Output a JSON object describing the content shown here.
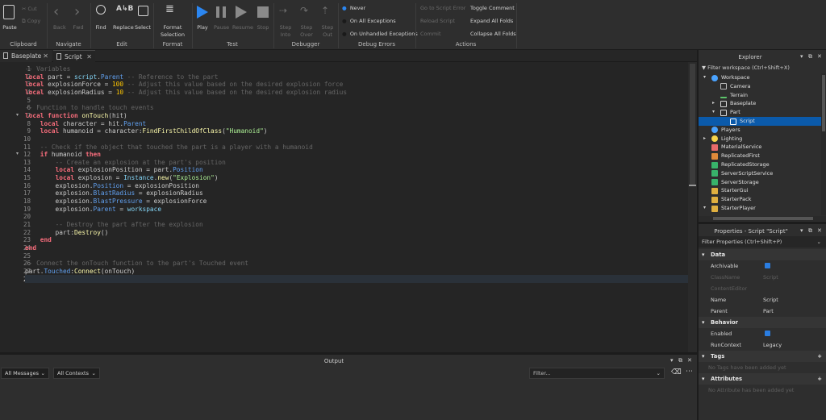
{
  "ribbon": {
    "clipboard": {
      "paste": "Paste",
      "cut": "Cut",
      "copy": "Copy",
      "label": "Clipboard"
    },
    "navigate": {
      "back": "Back",
      "fwd": "Fwd",
      "label": "Navigate"
    },
    "edit": {
      "find": "Find",
      "replace": "Replace",
      "select": "Select",
      "label": "Edit"
    },
    "format": {
      "selection": "Format Selection",
      "label": "Format"
    },
    "test": {
      "play": "Play",
      "pause": "Pause",
      "resume": "Resume",
      "stop": "Stop",
      "label": "Test"
    },
    "debugger": {
      "step_into": "Step Into",
      "step_over": "Step Over",
      "step_out": "Step Out",
      "label": "Debugger"
    },
    "debug_errors": {
      "never": "Never",
      "all": "On All Exceptions",
      "unhandled": "On Unhandled Exceptions",
      "label": "Debug Errors"
    },
    "actions": {
      "goto_error": "Go to Script Error",
      "reload": "Reload Script",
      "commit": "Commit",
      "toggle_comment": "Toggle Comment",
      "expand": "Expand All Folds",
      "collapse": "Collapse All Folds",
      "label": "Actions"
    }
  },
  "tabs": [
    {
      "label": "Baseplate"
    },
    {
      "label": "Script"
    }
  ],
  "editor": {
    "line_numbers": [
      "1",
      "2",
      "3",
      "4",
      "5",
      "6",
      "7",
      "8",
      "9",
      "10",
      "11",
      "12",
      "13",
      "14",
      "15",
      "16",
      "17",
      "18",
      "19",
      "20",
      "21",
      "22",
      "23",
      "24",
      "25",
      "26",
      "27",
      "28"
    ]
  },
  "output": {
    "title": "Output",
    "messages_filter": "All Messages",
    "contexts_filter": "All Contexts",
    "filter_placeholder": "Filter..."
  },
  "explorer": {
    "title": "Explorer",
    "filter": "Filter workspace (Ctrl+Shift+X)",
    "items": [
      {
        "label": "Workspace",
        "color": "#4aa3ff"
      },
      {
        "label": "Camera",
        "color": "#bdbdbd"
      },
      {
        "label": "Terrain",
        "color": "#5cc46a"
      },
      {
        "label": "Baseplate",
        "color": "#d8d8d8"
      },
      {
        "label": "Part",
        "color": "#d8d8d8"
      },
      {
        "label": "Script",
        "color": "#ffffff"
      },
      {
        "label": "Players",
        "color": "#4aa3ff"
      },
      {
        "label": "Lighting",
        "color": "#f6d34a"
      },
      {
        "label": "MaterialService",
        "color": "#e86a6a"
      },
      {
        "label": "ReplicatedFirst",
        "color": "#e08a3a"
      },
      {
        "label": "ReplicatedStorage",
        "color": "#38b36a"
      },
      {
        "label": "ServerScriptService",
        "color": "#38b36a"
      },
      {
        "label": "ServerStorage",
        "color": "#38b36a"
      },
      {
        "label": "StarterGui",
        "color": "#e0b040"
      },
      {
        "label": "StarterPack",
        "color": "#e0b040"
      },
      {
        "label": "StarterPlayer",
        "color": "#e0b040"
      }
    ]
  },
  "properties": {
    "title": "Properties - Script \"Script\"",
    "filter": "Filter Properties (Ctrl+Shift+P)",
    "data_section": "Data",
    "archivable": "Archivable",
    "classname_k": "ClassName",
    "classname_v": "Script",
    "contenteditor": "ContentEditor",
    "name_k": "Name",
    "name_v": "Script",
    "parent_k": "Parent",
    "parent_v": "Part",
    "behavior_section": "Behavior",
    "enabled": "Enabled",
    "runcontext_k": "RunContext",
    "runcontext_v": "Legacy",
    "tags_section": "Tags",
    "tags_empty": "No Tags have been added yet",
    "attributes_section": "Attributes",
    "attributes_empty": "No Attribute has been added yet"
  }
}
